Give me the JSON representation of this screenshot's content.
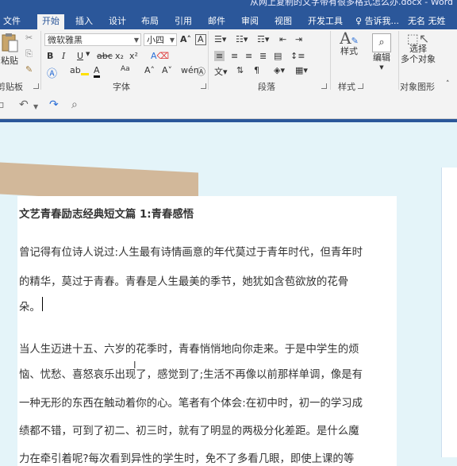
{
  "window": {
    "title": "从网上复制的文字带有很多格式怎么办.docx - Word"
  },
  "tabs": [
    "文件",
    "开始",
    "插入",
    "设计",
    "布局",
    "引用",
    "邮件",
    "审阅",
    "视图",
    "开发工具"
  ],
  "tell_me": "告诉我...",
  "user_name": "无名 无姓",
  "clipboard": {
    "paste_label": "粘贴",
    "group_label": "剪贴板"
  },
  "font": {
    "family": "微软雅黑",
    "size": "小四",
    "group_label": "字体",
    "bold": "B",
    "italic": "I",
    "underline": "U",
    "strikethrough": "abc",
    "subscript": "x₂",
    "superscript": "x²",
    "grow": "A",
    "shrink": "A",
    "change_case": "Aa",
    "clear": "A",
    "font_color": "A",
    "char_border": "A",
    "highlight": "ab"
  },
  "paragraph": {
    "group_label": "段落"
  },
  "styles": {
    "label": "样式",
    "group_label": "样式"
  },
  "editing": {
    "label": "编辑"
  },
  "select": {
    "label_line1": "选择",
    "label_line2": "多个对象",
    "group_label": "对象图形"
  },
  "document": {
    "heading": "文艺青春励志经典短文篇 1:青春感悟",
    "lines": [
      "曾记得有位诗人说过:人生最有诗情画意的年代莫过于青年时代，但青年时",
      "的精华，莫过于青春。青春是人生最美的季节，她犹如含苞欲放的花骨",
      "朵。",
      "当人生迈进十五、六岁的花季时，青春悄悄地向你走来。于是中学生的烦",
      "恼、忧愁、喜怒哀乐出现了，感觉到了;生活不再像以前那样单调，像是有",
      "一种无形的东西在触动着你的心。笔者有个体会:在初中时，初一的学习成",
      "绩都不错，可到了初二、初三时，就有了明显的两极分化差距。是什么魔",
      "力在牵引着呢?每次看到异性的学生时，免不了多看几眼，即使上课的等"
    ]
  },
  "colors": {
    "accent": "#2b579a",
    "canvas": "#e4f4f9"
  }
}
